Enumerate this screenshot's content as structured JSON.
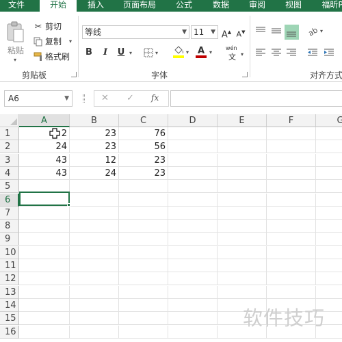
{
  "tabs": [
    "文件",
    "开始",
    "插入",
    "页面布局",
    "公式",
    "数据",
    "审阅",
    "视图",
    "福昕P"
  ],
  "active_tab": "开始",
  "accent_color": "#217346",
  "clipboard": {
    "paste_label": "粘贴",
    "cut_label": "剪切",
    "copy_label": "复制",
    "format_painter_label": "格式刷",
    "group_label": "剪贴板"
  },
  "font": {
    "font_name": "等线",
    "font_size": "11",
    "bold": "B",
    "italic": "I",
    "underline": "U",
    "group_label": "字体",
    "phonetic_top": "wén",
    "phonetic_bottom": "文",
    "increase_size": "A",
    "decrease_size": "A",
    "font_color_letter": "A",
    "font_color": "#c00000",
    "highlight_color": "#ffff00"
  },
  "alignment": {
    "group_label": "对齐方式"
  },
  "formula_bar": {
    "name_box": "A6",
    "cancel": "✕",
    "enter": "✓",
    "fx": "fx",
    "content": ""
  },
  "grid": {
    "columns": [
      "A",
      "B",
      "C",
      "D",
      "E",
      "F",
      "G"
    ],
    "rows": [
      "1",
      "2",
      "3",
      "4",
      "5",
      "6",
      "7",
      "8",
      "9",
      "10",
      "11",
      "12",
      "13",
      "14",
      "15",
      "16"
    ],
    "selected_column": "A",
    "selected_row": "6",
    "cells": [
      [
        "2",
        "23",
        "76"
      ],
      [
        "24",
        "23",
        "56"
      ],
      [
        "43",
        "12",
        "23"
      ],
      [
        "43",
        "24",
        "23"
      ]
    ]
  },
  "watermark": "软件技巧"
}
